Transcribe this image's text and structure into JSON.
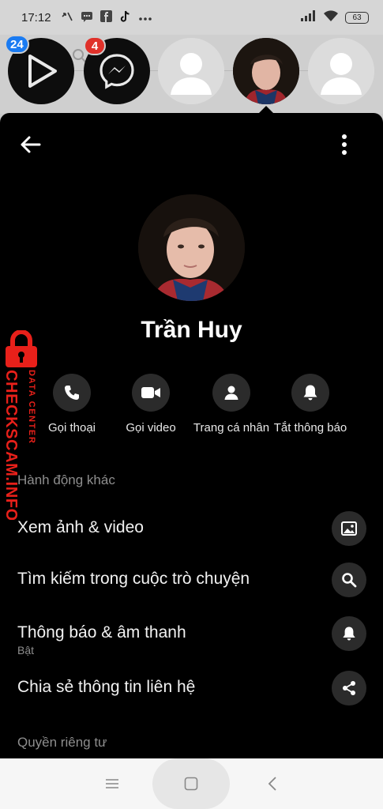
{
  "status_bar": {
    "time": "17:12",
    "battery": "63"
  },
  "chat_heads": [
    {
      "name": "video-app-head",
      "badge": "24",
      "badge_color": "#1a7bf2"
    },
    {
      "name": "messenger-head",
      "badge": "4",
      "badge_color": "#e0312a"
    },
    {
      "name": "contact-head-1",
      "badge": null
    },
    {
      "name": "contact-head-active",
      "badge": null
    },
    {
      "name": "contact-head-2",
      "badge": null
    }
  ],
  "profile": {
    "name": "Trần Huy"
  },
  "quick_actions": [
    {
      "id": "call",
      "label": "Gọi thoại",
      "icon": "phone-icon"
    },
    {
      "id": "video",
      "label": "Gọi video",
      "icon": "video-camera-icon"
    },
    {
      "id": "profile",
      "label": "Trang cá nhân",
      "icon": "person-icon"
    },
    {
      "id": "mute",
      "label": "Tắt thông báo",
      "icon": "bell-icon"
    }
  ],
  "sections": {
    "more_actions": "Hành động khác",
    "privacy": "Quyền riêng tư"
  },
  "menu_rows": [
    {
      "id": "media",
      "title": "Xem ảnh & video",
      "icon": "image-icon"
    },
    {
      "id": "search",
      "title": "Tìm kiếm trong cuộc trò chuyện",
      "icon": "search-icon"
    },
    {
      "id": "notifications",
      "title": "Thông báo & âm thanh",
      "subtitle": "Bật",
      "icon": "bell-icon"
    },
    {
      "id": "share",
      "title": "Chia sẻ thông tin liên hệ",
      "icon": "share-icon"
    }
  ],
  "watermark": {
    "line1": "DATA CENTER",
    "line2": "CHECKSCAM.INFO"
  },
  "colors": {
    "sheet_bg": "#000000",
    "circle_bg": "#2b2b2b",
    "muted_text": "#8e8e8e",
    "watermark_red": "#e8201a"
  }
}
